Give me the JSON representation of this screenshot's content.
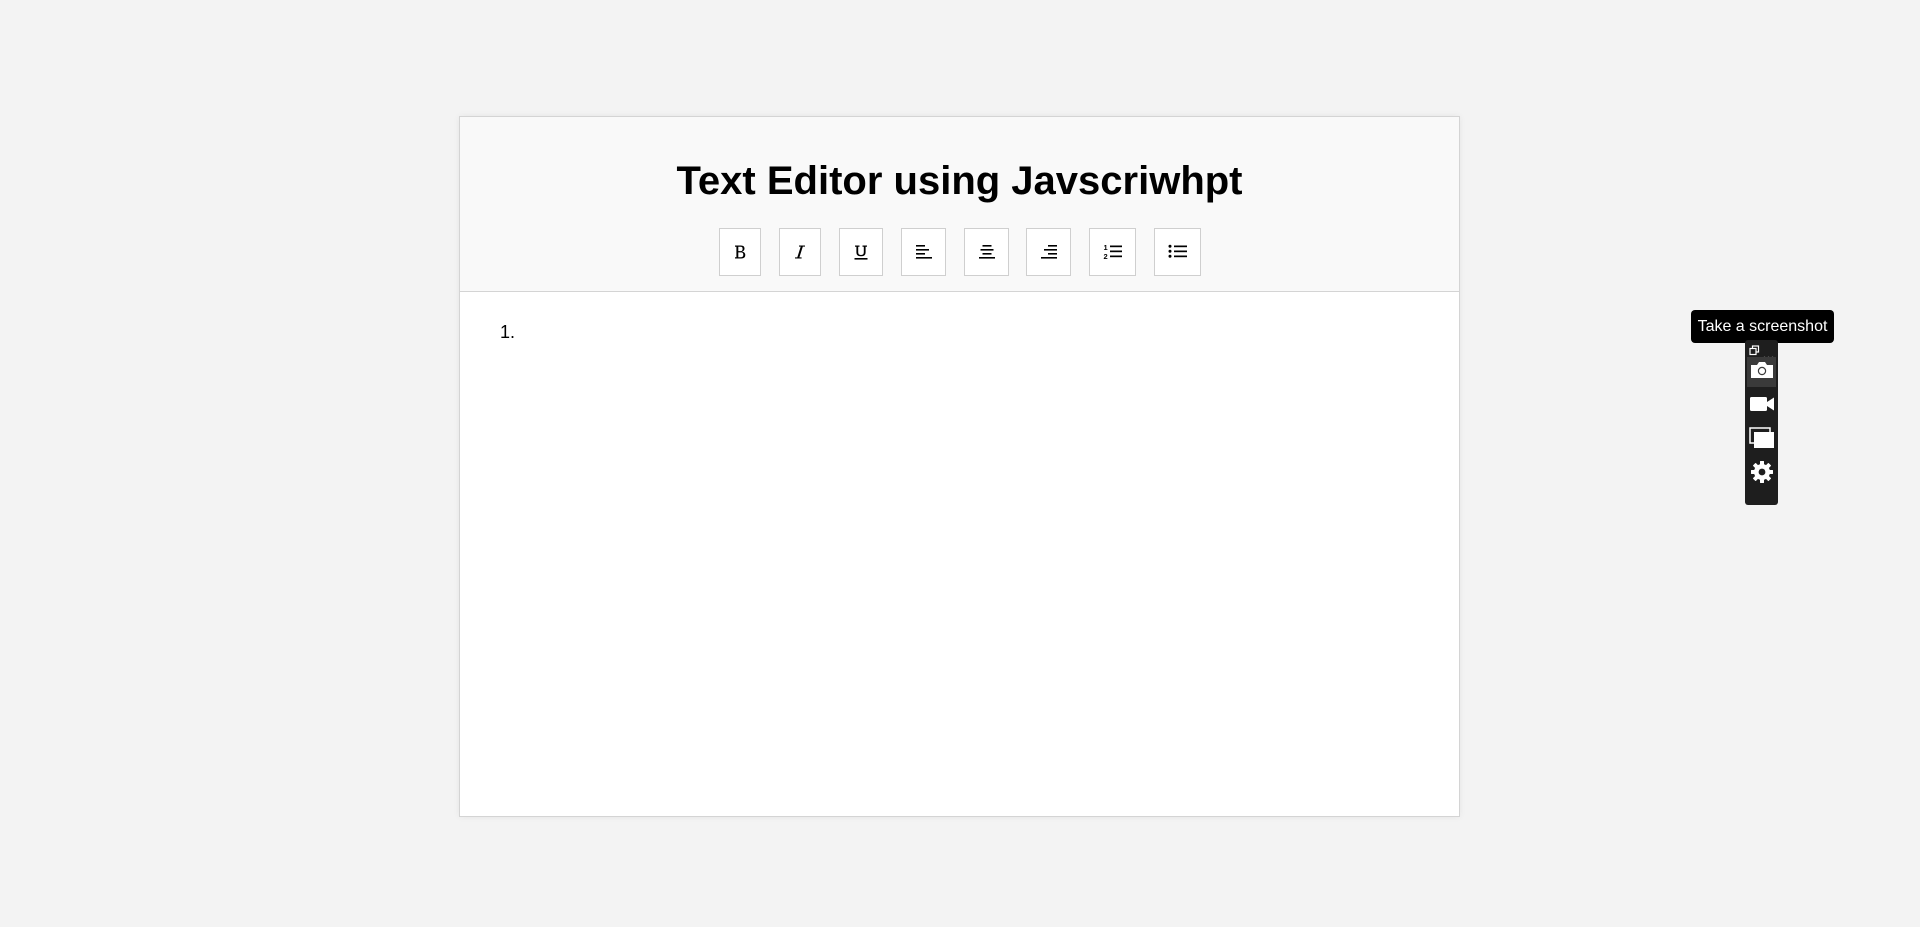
{
  "editor": {
    "title": "Text Editor using Javscriwhpt",
    "toolbar": [
      {
        "name": "bold-button",
        "icon": "bold-icon",
        "label": "B"
      },
      {
        "name": "italic-button",
        "icon": "italic-icon",
        "label": "I"
      },
      {
        "name": "underline-button",
        "icon": "underline-icon",
        "label": "U"
      },
      {
        "name": "align-left-button",
        "icon": "align-left-icon"
      },
      {
        "name": "align-center-button",
        "icon": "align-center-icon"
      },
      {
        "name": "align-right-button",
        "icon": "align-right-icon"
      },
      {
        "name": "ordered-list-button",
        "icon": "ordered-list-icon"
      },
      {
        "name": "unordered-list-button",
        "icon": "unordered-list-icon"
      }
    ],
    "content": {
      "list_items": [
        {
          "marker": "1.",
          "text": ""
        }
      ]
    }
  },
  "screenshot_tool": {
    "tooltip": "Take a screenshot",
    "buttons": [
      {
        "name": "screenshot-button",
        "icon": "camera-icon"
      },
      {
        "name": "record-video-button",
        "icon": "video-camera-icon"
      },
      {
        "name": "screenshot-region-button",
        "icon": "window-stack-icon"
      },
      {
        "name": "settings-button",
        "icon": "gear-icon"
      }
    ]
  },
  "colors": {
    "page_background": "#f3f3f3",
    "header_background": "#f9f9f9",
    "widget_background": "#1e1e1e"
  }
}
